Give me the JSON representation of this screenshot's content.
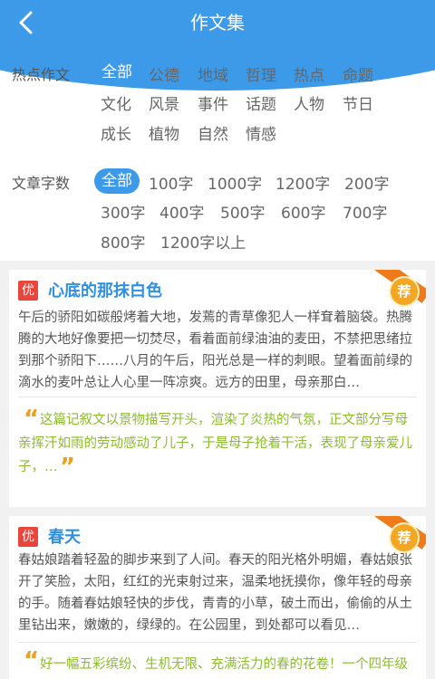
{
  "header": {
    "title": "作文集",
    "back_icon": "chevron-left-icon"
  },
  "filters": {
    "hot": {
      "label": "热点作文",
      "tags": [
        "全部",
        "公德",
        "地域",
        "哲理",
        "热点",
        "命题",
        "文化",
        "风景",
        "事件",
        "话题",
        "人物",
        "节日",
        "成长",
        "植物",
        "自然",
        "情感"
      ],
      "selected": "全部"
    },
    "words": {
      "label": "文章字数",
      "tags": [
        "全部",
        "100字",
        "1000字",
        "1200字",
        "200字",
        "300字",
        "400字",
        "500字",
        "600字",
        "700字",
        "800字",
        "1200字以上"
      ],
      "selected": "全部"
    }
  },
  "articles": [
    {
      "badge": "优",
      "title": "心底的那抹白色",
      "medal": "荐",
      "excerpt": "午后的骄阳如碳般烤着大地，发蔫的青草像犯人一样耷着脑袋。热腾腾的大地好像要把一切焚尽，看着面前绿油油的麦田，不禁把思绪拉到那个骄阳下……八月的午后，阳光总是一样的刺眼。望着面前绿的滴水的麦叶总让人心里一阵凉爽。远方的田里，母亲那白…",
      "comment": "这篇记叙文以景物描写开头，渲染了炎热的气氛，正文部分写母亲挥汗如雨的劳动感动了儿子，于是母子抢着干活，表现了母亲爱儿子，…"
    },
    {
      "badge": "优",
      "title": "春天",
      "medal": "荐",
      "excerpt": "春姑娘踏着轻盈的脚步来到了人间。春天的阳光格外明媚，春姑娘张开了笑脸，太阳，红红的光束射过来，温柔地抚摸你，像年轻的母亲的手。随着春姑娘轻快的步伐，青青的小草，破土而出，偷偷的从土里钻出来，嫩嫩的，绿绿的。在公园里，到处都可以看见…",
      "comment": "好一幅五彩缤纷、生机无限、充满活力的春的花卷！一个四年级"
    }
  ],
  "colors": {
    "accent": "#3d9ae8",
    "title_blue": "#2f8fe0",
    "comment_green": "#8bbd2b",
    "badge_red": "#e8453c",
    "medal_orange": "#f5a623"
  }
}
